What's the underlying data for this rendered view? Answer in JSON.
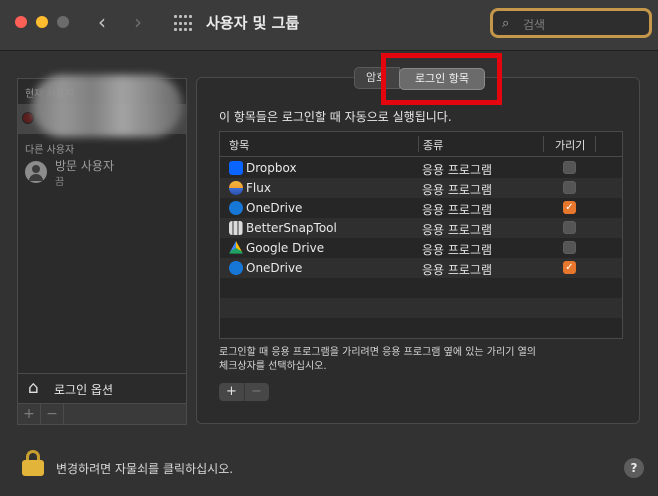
{
  "window": {
    "title": "사용자 및 그룹",
    "search_placeholder": "검색"
  },
  "sidebar": {
    "current_user_header": "현재 사용자",
    "other_users_header": "다른 사용자",
    "guest_name": "방문 사용자",
    "guest_status": "끔",
    "login_options_label": "로그인 옵션"
  },
  "tabs": {
    "password_tab": "암호",
    "login_items_tab": "로그인 항목",
    "selected": "로그인 항목"
  },
  "login_items": {
    "description": "이 항목들은 로그인할 때 자동으로 실행됩니다.",
    "columns": {
      "item": "항목",
      "kind": "종류",
      "hide": "가리기"
    },
    "rows": [
      {
        "name": "Dropbox",
        "kind": "응용 프로그램",
        "hidden": false,
        "icon": "dropbox-icon"
      },
      {
        "name": "Flux",
        "kind": "응용 프로그램",
        "hidden": false,
        "icon": "flux-icon"
      },
      {
        "name": "OneDrive",
        "kind": "응용 프로그램",
        "hidden": true,
        "icon": "onedrive-icon"
      },
      {
        "name": "BetterSnapTool",
        "kind": "응용 프로그램",
        "hidden": false,
        "icon": "bettersnaptool-icon"
      },
      {
        "name": "Google Drive",
        "kind": "응용 프로그램",
        "hidden": false,
        "icon": "google-drive-icon"
      },
      {
        "name": "OneDrive",
        "kind": "응용 프로그램",
        "hidden": true,
        "icon": "onedrive-icon"
      }
    ],
    "note_line1": "로그인할 때 응용 프로그램을 가리려면 응용 프로그램 옆에 있는 가리기 열의",
    "note_line2": "체크상자를 선택하십시오."
  },
  "footer": {
    "lock_text": "변경하려면 자물쇠를 클릭하십시오.",
    "help_label": "?"
  },
  "colors": {
    "accent_orange": "#e6772c",
    "highlight_red": "#e3060e",
    "search_ring": "#c4974a"
  }
}
